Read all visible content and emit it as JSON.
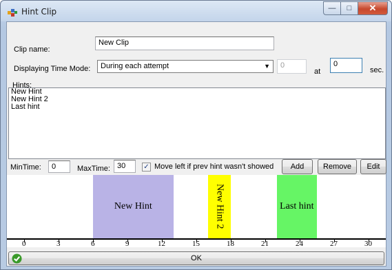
{
  "window": {
    "title": "Hint Clip",
    "min_glyph": "—",
    "max_glyph": "□",
    "close_glyph": "✕"
  },
  "form": {
    "clip_name_label": "Clip name:",
    "clip_name_value": "New Clip",
    "time_mode_label": "Displaying Time Mode:",
    "time_mode_value": "During each attempt",
    "time_mode_arrow": "▼",
    "attempt_value": "0",
    "at_label": "at",
    "at_value": "0",
    "sec_label": "sec.",
    "hints_label": "Hints:",
    "hints": [
      "New Hint",
      "New Hint 2",
      "Last hint"
    ],
    "min_time_label": "MinTime:",
    "min_time_value": "0",
    "max_time_label": "MaxTime:",
    "max_time_value": "30",
    "move_left_label": "Move left if prev hint wasn't showed",
    "move_left_checked": true,
    "check_glyph": "✓",
    "add_label": "Add",
    "remove_label": "Remove",
    "edit_label": "Edit"
  },
  "timeline": {
    "min": 0,
    "max": 30,
    "blocks": [
      {
        "label": "New Hint",
        "start": 6,
        "end": 13,
        "color": "#b9b3e6",
        "vertical": false
      },
      {
        "label": "New Hint 2",
        "start": 16,
        "end": 18,
        "color": "#ffff00",
        "vertical": true
      },
      {
        "label": "Last hint",
        "start": 22,
        "end": 25.5,
        "color": "#66f565",
        "vertical": false
      }
    ],
    "ticks": [
      "0",
      "3",
      "6",
      "9",
      "12",
      "15",
      "18",
      "21",
      "24",
      "27",
      "30"
    ]
  },
  "ok_label": "OK",
  "colors": {
    "ok_icon": "#3a9a2a"
  }
}
